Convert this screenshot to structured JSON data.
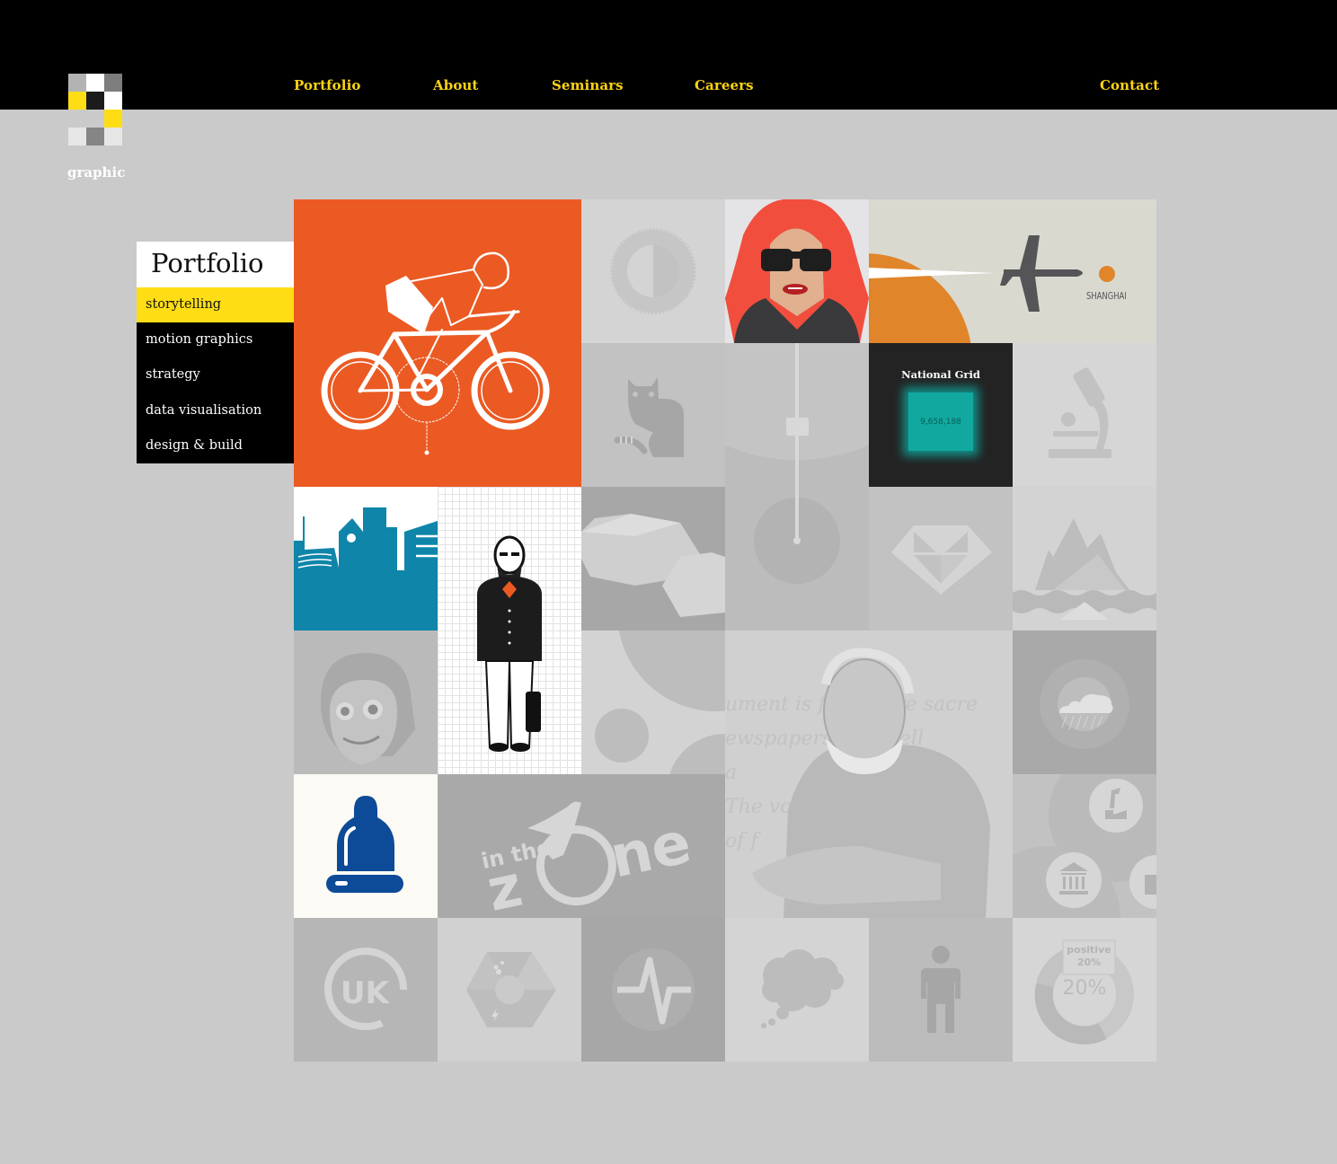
{
  "brand": {
    "name": "graphic",
    "logo_colors": [
      "#b3b3b3",
      "#ffffff",
      "#7d7d7d",
      "#fedd15",
      "#1b1b1b",
      "#ffffff",
      "#cacaca",
      "#cacaca",
      "#fedd15",
      "#e6e6e6",
      "#858585",
      "#e6e6e6"
    ]
  },
  "nav": {
    "items": [
      {
        "label": "Portfolio"
      },
      {
        "label": "About"
      },
      {
        "label": "Seminars"
      },
      {
        "label": "Careers"
      }
    ],
    "contact_label": "Contact"
  },
  "colors": {
    "nav_text": "#fcd313",
    "active_yellow": "#fedd15",
    "background": "#cacaca",
    "cyclist_orange": "#eb5a23",
    "skyline_blue": "#0f85aa",
    "bell_blue": "#0d4a97"
  },
  "sidebar": {
    "title": "Portfolio",
    "items": [
      {
        "label": "storytelling",
        "active": true
      },
      {
        "label": "motion graphics",
        "active": false
      },
      {
        "label": "strategy",
        "active": false
      },
      {
        "label": "data visualisation",
        "active": false
      },
      {
        "label": "design & build",
        "active": false
      }
    ]
  },
  "tiles": {
    "cyclist": {
      "label": "cyclist illustration"
    },
    "dial": {
      "label": "contrast dial icon"
    },
    "redhead": {
      "label": "woman with sunglasses illustration"
    },
    "plane": {
      "label": "plane to Shanghai",
      "city": "SHANGHAI"
    },
    "cat": {
      "label": "cat icon"
    },
    "pendulum": {
      "label": "pendulum slider graphic"
    },
    "national_grid": {
      "title": "National Grid",
      "value": "9,658,188"
    },
    "microscope": {
      "label": "microscope icon"
    },
    "skyline": {
      "label": "city skyline"
    },
    "businessman": {
      "label": "bearded businessman figure"
    },
    "rocks": {
      "label": "low-poly rocks"
    },
    "diamond": {
      "label": "diamond icon"
    },
    "mountain": {
      "label": "mountain and sea"
    },
    "girl": {
      "label": "cartoon girl"
    },
    "circles": {
      "label": "circles pattern"
    },
    "oldman": {
      "label": "old man portrait",
      "bg_lines": [
        "ument is fr    ts are sacre",
        "ewspapers        well",
        "a",
        "The vo          ha",
        "of f           ar"
      ]
    },
    "weather": {
      "label": "rain cloud icon"
    },
    "bell": {
      "label": "bell icon"
    },
    "inthezone": {
      "small": "in the",
      "big_left": "z",
      "big_right": "ne"
    },
    "industry": {
      "label": "industry icons"
    },
    "uk": {
      "text": "UK"
    },
    "hexagon": {
      "label": "hexagon infographic"
    },
    "pulse": {
      "label": "pulse line icon"
    },
    "thought": {
      "label": "thought bubble icon"
    },
    "person": {
      "label": "person icon"
    },
    "donut": {
      "tag_line1": "positive",
      "tag_line2": "20%",
      "center": "20%"
    }
  }
}
